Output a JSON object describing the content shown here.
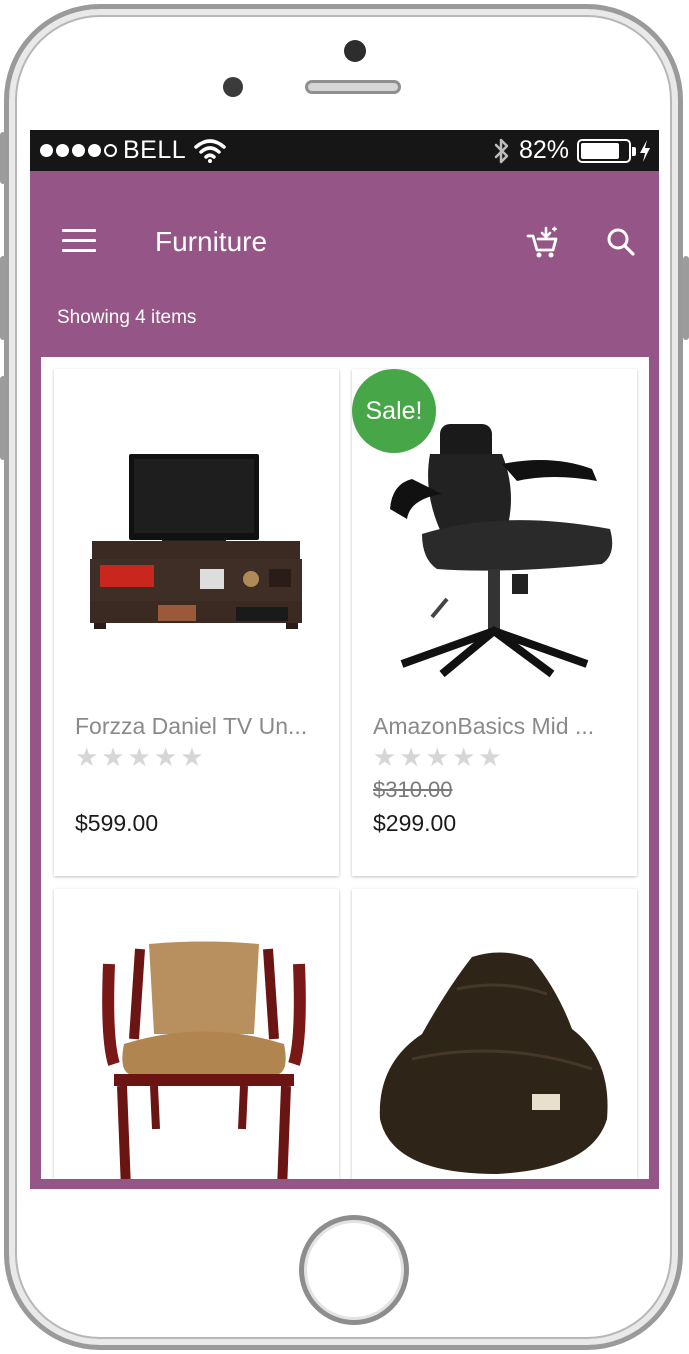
{
  "status_bar": {
    "carrier": "BELL",
    "battery_percent": "82%",
    "battery_level": 0.82,
    "signal_bars": 4,
    "signal_max": 5
  },
  "app_bar": {
    "title": "Furniture",
    "icons": [
      "menu-icon",
      "cart-icon",
      "search-icon"
    ]
  },
  "listing": {
    "count_text": "Showing 4 items"
  },
  "colors": {
    "primary": "#955587",
    "sale_badge": "#47a648"
  },
  "products": [
    {
      "name": "Forzza Daniel TV Un...",
      "rating": 0,
      "rating_max": 5,
      "old_price": "",
      "price": "$599.00",
      "on_sale": false
    },
    {
      "name": "AmazonBasics Mid ...",
      "rating": 0,
      "rating_max": 5,
      "old_price": "$310.00",
      "price": "$299.00",
      "on_sale": true,
      "badge": "Sale!"
    },
    {
      "name": "",
      "price": "",
      "on_sale": false
    },
    {
      "name": "",
      "price": "",
      "on_sale": false
    }
  ]
}
